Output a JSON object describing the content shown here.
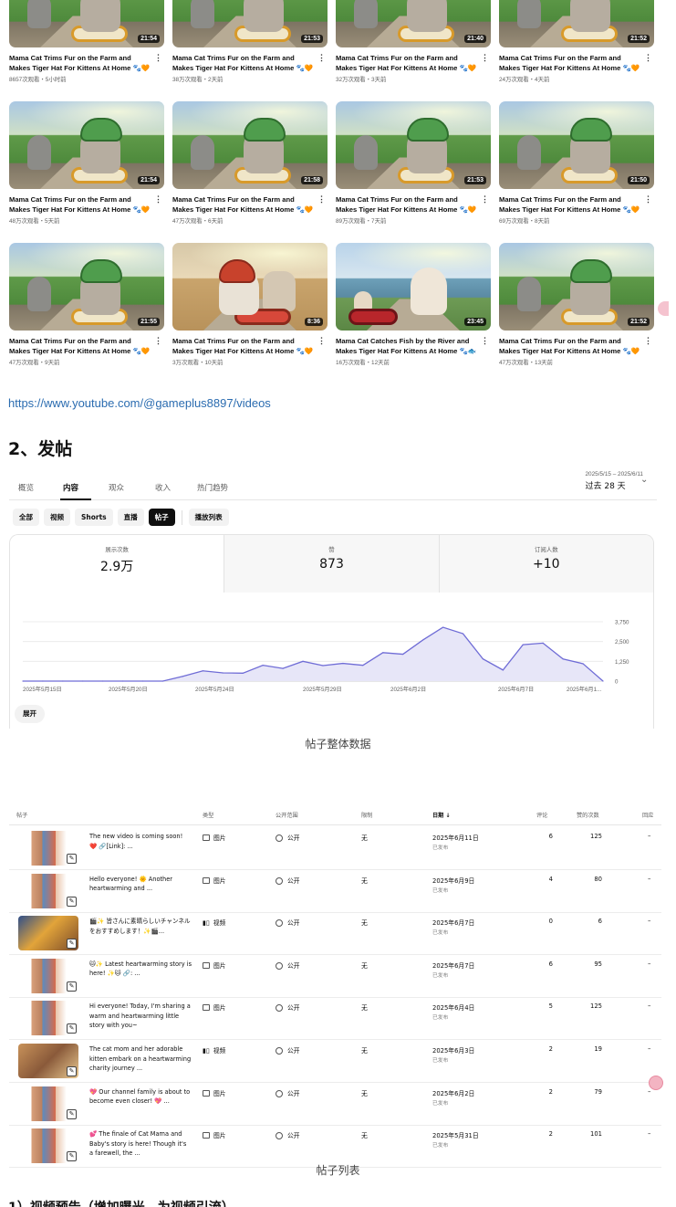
{
  "videos": [
    [
      {
        "title": "Mama Cat Trims Fur on the Farm and Makes Tiger Hat For Kittens At Home 🐾🧡🐯",
        "duration": "21:54",
        "stats": "8657次观看・5小时前"
      },
      {
        "title": "Mama Cat Trims Fur on the Farm and Makes Tiger Hat For Kittens At Home 🐾🧡🐯",
        "duration": "21:53",
        "stats": "38万次观看・2天前"
      },
      {
        "title": "Mama Cat Trims Fur on the Farm and Makes Tiger Hat For Kittens At Home 🐾🧡🐯",
        "duration": "21:40",
        "stats": "32万次观看・3天前"
      },
      {
        "title": "Mama Cat Trims Fur on the Farm and Makes Tiger Hat For Kittens At Home 🐾🧡🐯",
        "duration": "21:52",
        "stats": "24万次观看・4天前"
      }
    ],
    [
      {
        "title": "Mama Cat Trims Fur on the Farm and Makes Tiger Hat For Kittens At Home 🐾🧡🐯",
        "duration": "21:54",
        "stats": "48万次观看・5天前"
      },
      {
        "title": "Mama Cat Trims Fur on the Farm and Makes Tiger Hat For Kittens At Home 🐾🧡🐯",
        "duration": "21:58",
        "stats": "47万次观看・6天前"
      },
      {
        "title": "Mama Cat Trims Fur on the Farm and Makes Tiger Hat For Kittens At Home 🐾🧡🐯",
        "duration": "21:53",
        "stats": "89万次观看・7天前"
      },
      {
        "title": "Mama Cat Trims Fur on the Farm and Makes Tiger Hat For Kittens At Home 🐾🧡🐯",
        "duration": "21:50",
        "stats": "69万次观看・8天前"
      }
    ],
    [
      {
        "title": "Mama Cat Trims Fur on the Farm and Makes Tiger Hat For Kittens At Home 🐾🧡🐯",
        "duration": "21:55",
        "stats": "47万次观看・9天前"
      },
      {
        "title": "Mama Cat Trims Fur on the Farm and Makes Tiger Hat For Kittens At Home 🐾🧡🐯",
        "duration": "8:36",
        "stats": "3万次观看・10天前"
      },
      {
        "title": "Mama Cat Catches Fish by the River and Makes Tiger Hat For Kittens At Home 🐾🐟🐯",
        "duration": "23:45",
        "stats": "16万次观看・12天前"
      },
      {
        "title": "Mama Cat Trims Fur on the Farm and Makes Tiger Hat For Kittens At Home 🐾🧡🐯",
        "duration": "21:52",
        "stats": "47万次观看・13天前"
      }
    ]
  ],
  "channel_link": "https://www.youtube.com/@gameplus8897/videos",
  "section_heading": "2、发帖",
  "analytics": {
    "tabs": [
      "概览",
      "内容",
      "观众",
      "收入",
      "热门趋势"
    ],
    "active_tab": "内容",
    "date_range_dates": "2025/5/15 – 2025/6/11",
    "date_range_label": "过去 28 天",
    "chips": [
      "全部",
      "视频",
      "Shorts",
      "直播",
      "帖子",
      "播放列表"
    ],
    "active_chip": "帖子",
    "metrics": [
      {
        "label": "展示次数",
        "value": "2.9万"
      },
      {
        "label": "赞",
        "value": "873"
      },
      {
        "label": "订阅人数",
        "value": "+10"
      }
    ],
    "expand_label": "展开",
    "accent": "#6f6cd6",
    "fill": "#e7e6f8"
  },
  "chart_data": {
    "type": "area",
    "x_tick_labels": [
      "2025年5月15日",
      "2025年5月20日",
      "2025年5月24日",
      "2025年5月29日",
      "2025年6月2日",
      "2025年6月7日",
      "2025年6月1..."
    ],
    "y_tick_labels": [
      "3,750",
      "2,500",
      "1,250",
      "0"
    ],
    "ylim": [
      0,
      3750
    ],
    "grid": true,
    "values": [
      0,
      0,
      0,
      0,
      0,
      0,
      0,
      0,
      300,
      650,
      520,
      500,
      1000,
      800,
      1250,
      980,
      1120,
      1000,
      1800,
      1700,
      2600,
      3400,
      3000,
      1400,
      700,
      2300,
      2400,
      1400,
      1100,
      0
    ]
  },
  "captions": {
    "overview": "帖子整体数据",
    "list": "帖子列表"
  },
  "posts_table": {
    "headers": {
      "post": "帖子",
      "type": "类型",
      "visibility": "公开范围",
      "restrictions": "限制",
      "date": "日期 ↓",
      "comments": "评论",
      "likes": "赞的次数",
      "replies": "回应"
    },
    "rows": [
      {
        "text": "The new video is coming soon! ❤️ 🔗[Link]: ...",
        "type": "图片",
        "vis": "公开",
        "restrict": "无",
        "date": "2025年6月11日",
        "status": "已发布",
        "comments": "6",
        "likes": "125",
        "reply": "–",
        "thumb": "img"
      },
      {
        "text": "Hello everyone! 🌞 Another heartwarming and ...",
        "type": "图片",
        "vis": "公开",
        "restrict": "无",
        "date": "2025年6月9日",
        "status": "已发布",
        "comments": "4",
        "likes": "80",
        "reply": "–",
        "thumb": "img"
      },
      {
        "text": "🎬✨ 皆さんに素晴らしいチャンネルをおすすめします！✨🎬...",
        "type": "视频",
        "vis": "公开",
        "restrict": "无",
        "date": "2025年6月7日",
        "status": "已发布",
        "comments": "0",
        "likes": "6",
        "reply": "–",
        "thumb": "vid"
      },
      {
        "text": "🐱✨ Latest heartwarming story is here! ✨🐱 🔗: ...",
        "type": "图片",
        "vis": "公开",
        "restrict": "无",
        "date": "2025年6月7日",
        "status": "已发布",
        "comments": "6",
        "likes": "95",
        "reply": "–",
        "thumb": "img"
      },
      {
        "text": "Hi everyone! Today, I'm sharing a warm and heartwarming little story with you~",
        "type": "图片",
        "vis": "公开",
        "restrict": "无",
        "date": "2025年6月4日",
        "status": "已发布",
        "comments": "5",
        "likes": "125",
        "reply": "–",
        "thumb": "img"
      },
      {
        "text": "The cat mom and her adorable kitten embark on a heartwarming charity journey ...",
        "type": "视频",
        "vis": "公开",
        "restrict": "无",
        "date": "2025年6月3日",
        "status": "已发布",
        "comments": "2",
        "likes": "19",
        "reply": "–",
        "thumb": "vid2"
      },
      {
        "text": "💖 Our channel family is about to become even closer! 💖 ...",
        "type": "图片",
        "vis": "公开",
        "restrict": "无",
        "date": "2025年6月2日",
        "status": "已发布",
        "comments": "2",
        "likes": "79",
        "reply": "–",
        "thumb": "img"
      },
      {
        "text": "💕 The finale of Cat Mama and Baby's story is here! Though it's a farewell, the ...",
        "type": "图片",
        "vis": "公开",
        "restrict": "无",
        "date": "2025年5月31日",
        "status": "已发布",
        "comments": "2",
        "likes": "101",
        "reply": "–",
        "thumb": "img"
      }
    ]
  },
  "bottom_heading": "1）视频预告（增加曝光，为视频引流）"
}
